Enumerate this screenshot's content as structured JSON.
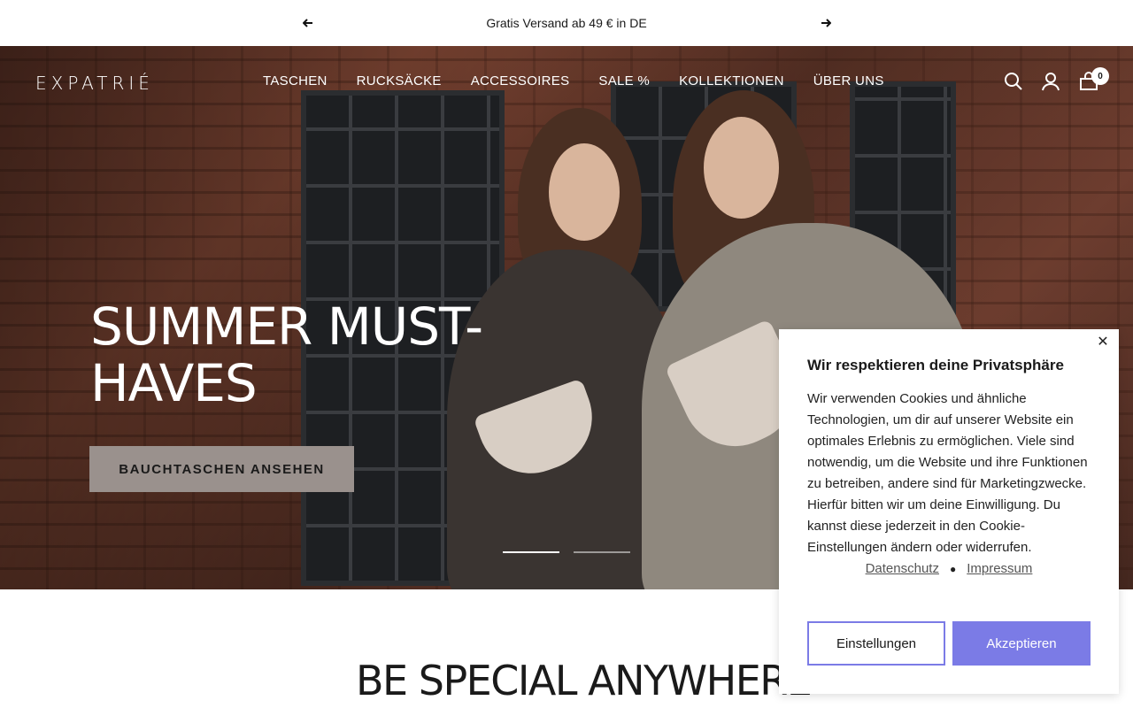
{
  "announcement": {
    "text": "Gratis Versand ab 49 € in DE",
    "prev_icon": "arrow-left-icon",
    "next_icon": "arrow-right-icon"
  },
  "header": {
    "logo": "EXPATRIÉ",
    "nav": [
      "TASCHEN",
      "RUCKSÄCKE",
      "ACCESSOIRES",
      "SALE %",
      "KOLLEKTIONEN",
      "ÜBER UNS"
    ],
    "icons": [
      "search-icon",
      "account-icon",
      "cart-icon"
    ],
    "cart_count": "0"
  },
  "hero": {
    "title": "SUMMER MUST-HAVES",
    "button": "BAUCHTASCHEN ANSEHEN",
    "slides_total": 2,
    "active_slide": 1
  },
  "section": {
    "title": "BE SPECIAL ANYWHERE"
  },
  "cookie": {
    "title": "Wir respektieren deine Privatsphäre",
    "text": "Wir verwenden Cookies und ähnliche Technologien, um dir auf unserer Website ein optimales Erlebnis zu ermöglichen. Viele sind notwendig, um die Website und ihre Funktionen zu betreiben, andere sind für Marketingzwecke. Hierfür bitten wir um deine Einwilligung. Du kannst diese jederzeit in den Cookie-Einstellungen ändern oder widerrufen.",
    "link_privacy": "Datenschutz",
    "link_imprint": "Impressum",
    "separator": "●",
    "close": "✕",
    "btn_settings": "Einstellungen",
    "btn_accept": "Akzeptieren",
    "accent_color": "#7b7be6"
  }
}
